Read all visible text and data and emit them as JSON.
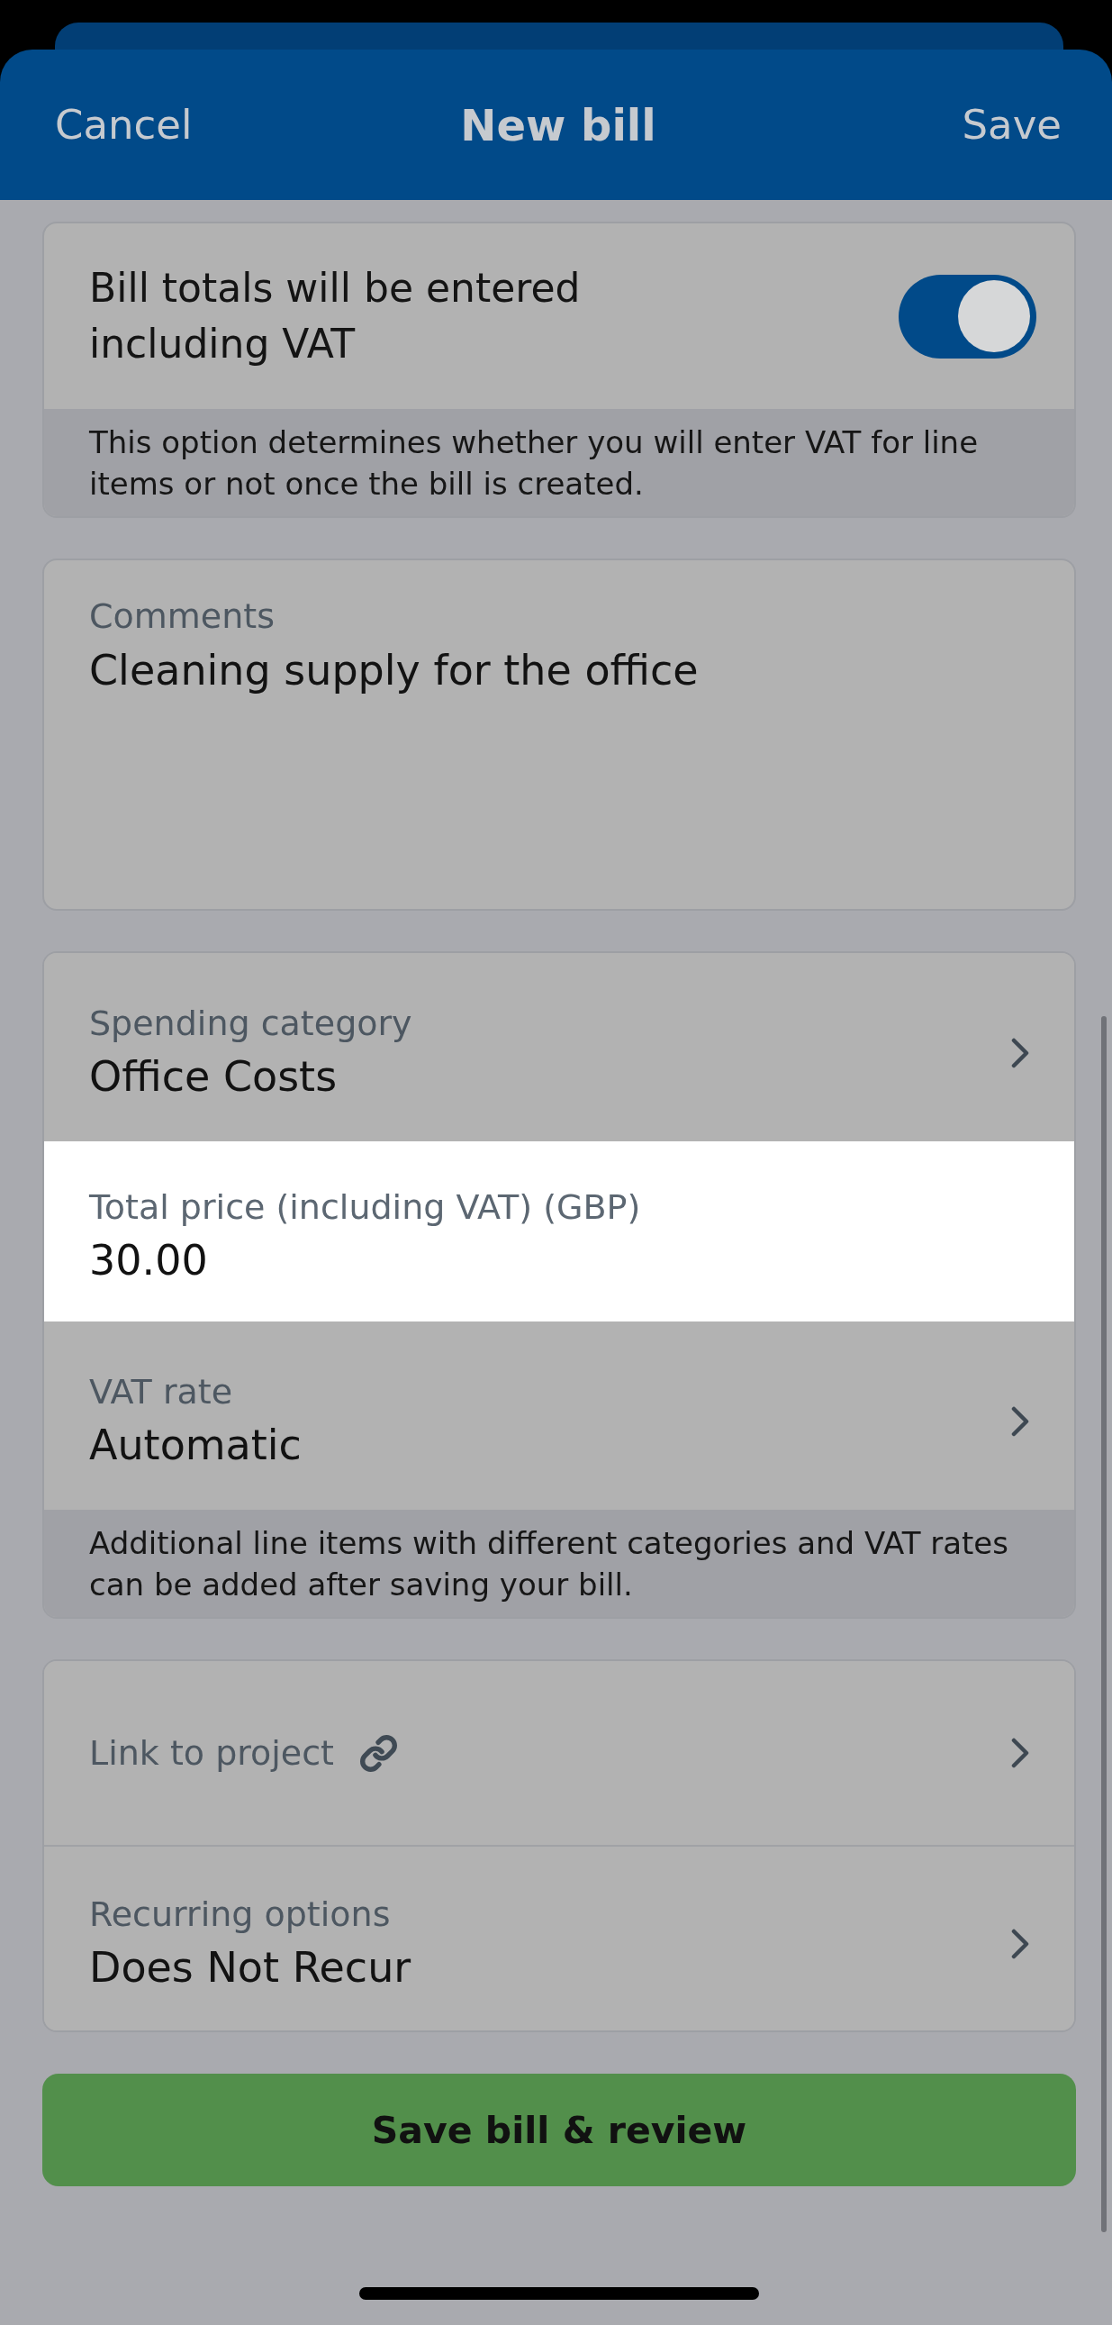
{
  "header": {
    "cancel": "Cancel",
    "title": "New bill",
    "save": "Save"
  },
  "vat_setting": {
    "label": "Bill totals will be entered including VAT",
    "on": true,
    "note": "This option determines whether you will enter VAT for line items or not once the bill is created."
  },
  "comments": {
    "label": "Comments",
    "value": "Cleaning supply for the office"
  },
  "line_item": {
    "rows": [
      {
        "kind": "picker",
        "label": "Spending category",
        "value": "Office Costs",
        "highlighted": false
      },
      {
        "kind": "input",
        "label": "Total price (including VAT) (GBP)",
        "value": "30.00",
        "highlighted": true
      },
      {
        "kind": "picker",
        "label": "VAT rate",
        "value": "Automatic",
        "highlighted": false
      }
    ],
    "note": "Additional line items with different categories and VAT rates can be added after saving your bill."
  },
  "options": {
    "rows": [
      {
        "kind": "link",
        "label": "Link to project"
      },
      {
        "kind": "picker",
        "label": "Recurring options",
        "value": "Does Not Recur"
      }
    ]
  },
  "save_button": "Save bill & review"
}
